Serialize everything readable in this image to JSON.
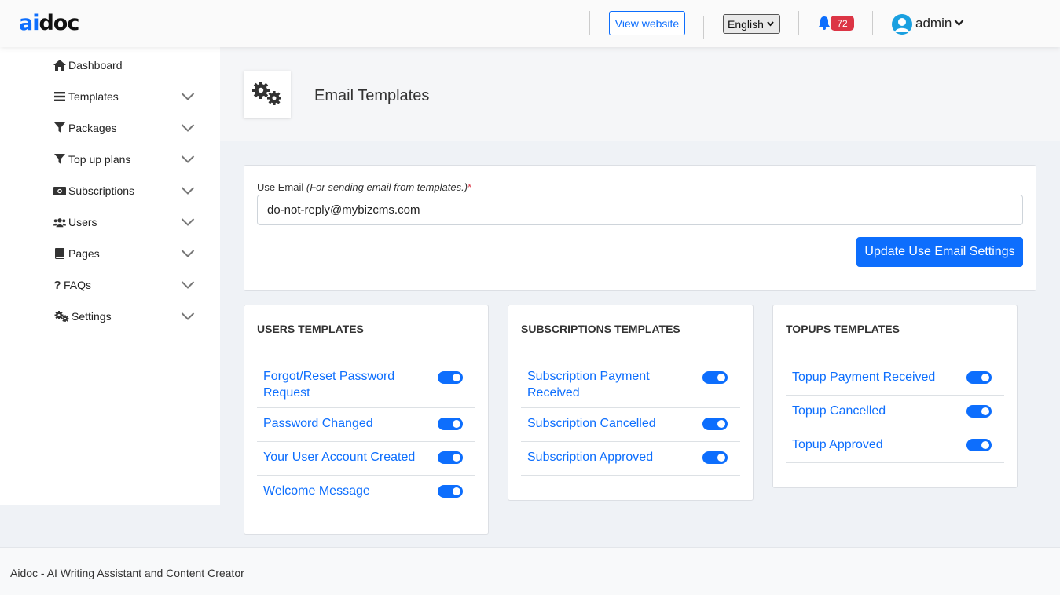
{
  "brand": {
    "logo_part1": "ai",
    "logo_part2": "doc"
  },
  "header": {
    "view_website": "View website",
    "language": "English",
    "notifications_count": "72",
    "user": "admin"
  },
  "sidebar": {
    "items": [
      {
        "label": "Dashboard",
        "icon": "home-icon"
      },
      {
        "label": "Templates",
        "icon": "list-icon"
      },
      {
        "label": "Packages",
        "icon": "filter-icon"
      },
      {
        "label": "Top up plans",
        "icon": "filter-icon"
      },
      {
        "label": "Subscriptions",
        "icon": "money-icon"
      },
      {
        "label": "Users",
        "icon": "users-icon"
      },
      {
        "label": "Pages",
        "icon": "book-icon"
      },
      {
        "label": "FAQs",
        "icon": "question-icon"
      },
      {
        "label": "Settings",
        "icon": "gears-icon"
      }
    ]
  },
  "page": {
    "title": "Email Templates"
  },
  "email_settings": {
    "label": "Use Email",
    "hint": "(For sending email from templates.)",
    "required_mark": "*",
    "value": "do-not-reply@mybizcms.com",
    "button": "Update Use Email Settings"
  },
  "users_templates": {
    "title": "USERS TEMPLATES",
    "items": [
      {
        "label": "Forgot/Reset Password Request",
        "enabled": true
      },
      {
        "label": "Password Changed",
        "enabled": true
      },
      {
        "label": "Your User Account Created",
        "enabled": true
      },
      {
        "label": "Welcome Message",
        "enabled": true
      }
    ]
  },
  "subscriptions_templates": {
    "title": "SUBSCRIPTIONS TEMPLATES",
    "items": [
      {
        "label": "Subscription Payment Received",
        "enabled": true
      },
      {
        "label": "Subscription Cancelled",
        "enabled": true
      },
      {
        "label": "Subscription Approved",
        "enabled": true
      }
    ]
  },
  "topups_templates": {
    "title": "TOPUPS TEMPLATES",
    "items": [
      {
        "label": "Topup Payment Received",
        "enabled": true
      },
      {
        "label": "Topup Cancelled",
        "enabled": true
      },
      {
        "label": "Topup Approved",
        "enabled": true
      }
    ]
  },
  "footer": {
    "text": "Aidoc - AI Writing Assistant and Content Creator"
  },
  "colors": {
    "accent": "#0d6efd",
    "badge": "#dc3545"
  }
}
